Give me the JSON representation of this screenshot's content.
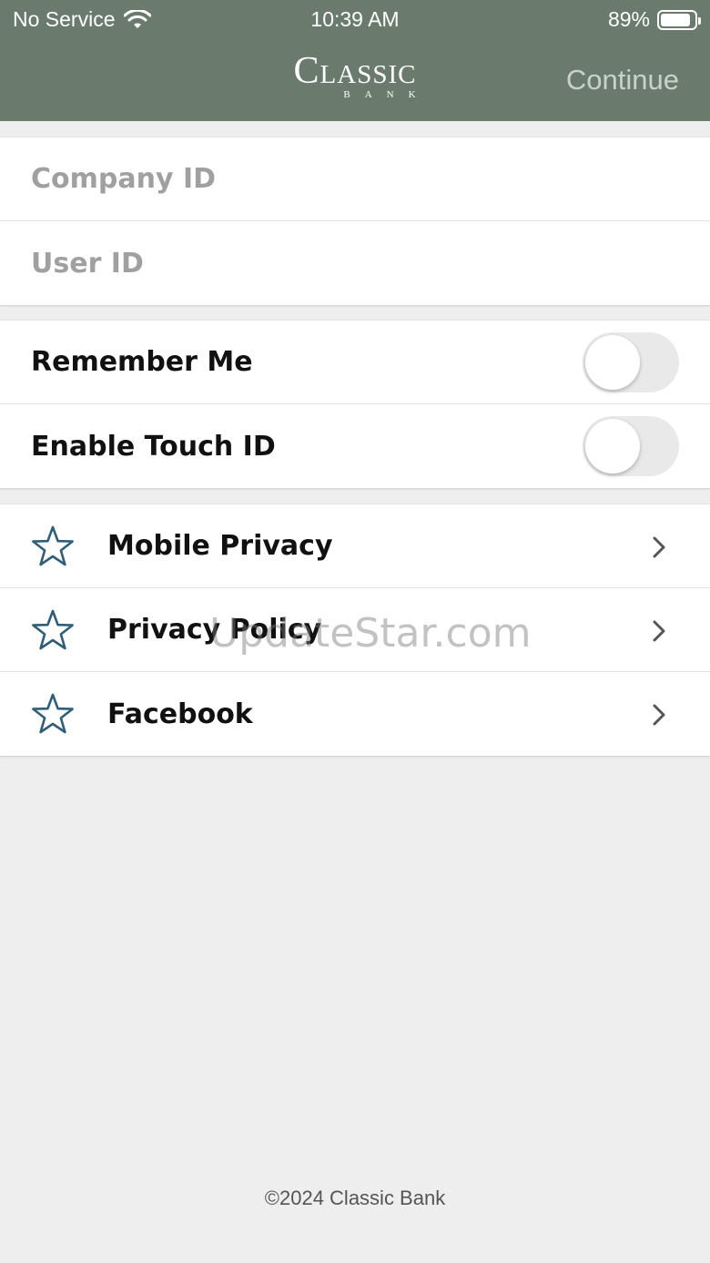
{
  "status_bar": {
    "carrier": "No Service",
    "time": "10:39 AM",
    "battery": "89%",
    "battery_level": 0.89
  },
  "header": {
    "logo_word": "Classic",
    "logo_sub": "BANK",
    "continue_label": "Continue"
  },
  "login": {
    "company_id_placeholder": "Company ID",
    "user_id_placeholder": "User ID"
  },
  "settings": {
    "remember_me": "Remember Me",
    "enable_touch_id": "Enable Touch ID"
  },
  "links": [
    {
      "label": "Mobile Privacy"
    },
    {
      "label": "Privacy Policy"
    },
    {
      "label": "Facebook"
    }
  ],
  "watermark": "UpdateStar.com",
  "footer": "©2024 Classic Bank",
  "colors": {
    "header_bg": "#6a7b6e",
    "star_icon": "#2f5e7a"
  }
}
